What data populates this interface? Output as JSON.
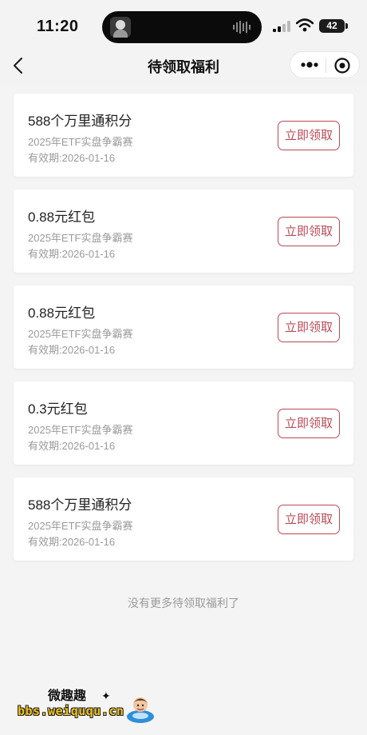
{
  "status_bar": {
    "time": "11:20",
    "battery": "42"
  },
  "nav": {
    "title": "待领取福利"
  },
  "cards": [
    {
      "title": "588个万里通积分",
      "subtitle": "2025年ETF实盘争霸赛",
      "expiry": "有效期:2026-01-16",
      "button": "立即领取"
    },
    {
      "title": "0.88元红包",
      "subtitle": "2025年ETF实盘争霸赛",
      "expiry": "有效期:2026-01-16",
      "button": "立即领取"
    },
    {
      "title": "0.88元红包",
      "subtitle": "2025年ETF实盘争霸赛",
      "expiry": "有效期:2026-01-16",
      "button": "立即领取"
    },
    {
      "title": "0.3元红包",
      "subtitle": "2025年ETF实盘争霸赛",
      "expiry": "有效期:2026-01-16",
      "button": "立即领取"
    },
    {
      "title": "588个万里通积分",
      "subtitle": "2025年ETF实盘争霸赛",
      "expiry": "有效期:2026-01-16",
      "button": "立即领取"
    }
  ],
  "footer": {
    "end_text": "没有更多待领取福利了"
  },
  "watermark": {
    "name": "微趣趣",
    "url": "bbs.weiququ.cn"
  },
  "colors": {
    "accent": "#b84a55",
    "background": "#f4f4f4",
    "muted_text": "#9a9a9a"
  },
  "icons": [
    "back-chevron-icon",
    "more-dots-icon",
    "close-target-icon",
    "signal-icon",
    "wifi-icon",
    "battery-icon",
    "audio-wave-icon"
  ]
}
